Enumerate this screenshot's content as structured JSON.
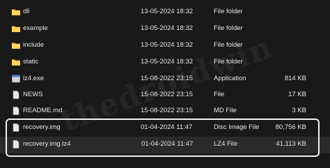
{
  "colors": {
    "background": "#191919",
    "folder": "#f3c649",
    "file_icon": "#e9e9e9",
    "text": "#e6e6e6",
    "selection_border": "#f2f2f2"
  },
  "watermark": "thedroidwin",
  "files": [
    {
      "name": "dll",
      "modified": "13-05-2024 18:32",
      "type": "File folder",
      "size": "",
      "icon": "folder-icon"
    },
    {
      "name": "example",
      "modified": "13-05-2024 18:32",
      "type": "File folder",
      "size": "",
      "icon": "folder-icon"
    },
    {
      "name": "include",
      "modified": "13-05-2024 18:32",
      "type": "File folder",
      "size": "",
      "icon": "folder-icon"
    },
    {
      "name": "static",
      "modified": "13-05-2024 18:32",
      "type": "File folder",
      "size": "",
      "icon": "folder-icon"
    },
    {
      "name": "lz4.exe",
      "modified": "15-08-2022 23:15",
      "type": "Application",
      "size": "814 KB",
      "icon": "application-icon"
    },
    {
      "name": "NEWS",
      "modified": "15-08-2022 23:15",
      "type": "File",
      "size": "17 KB",
      "icon": "document-icon"
    },
    {
      "name": "README.md",
      "modified": "15-08-2022 23:15",
      "type": "MD File",
      "size": "3 KB",
      "icon": "document-icon"
    },
    {
      "name": "recovery.img",
      "modified": "01-04-2024 11:47",
      "type": "Disc Image File",
      "size": "80,756 KB",
      "icon": "document-icon"
    },
    {
      "name": "recovery.img.lz4",
      "modified": "01-04-2024 11:47",
      "type": "LZ4 File",
      "size": "41,113 KB",
      "icon": "document-icon"
    }
  ]
}
